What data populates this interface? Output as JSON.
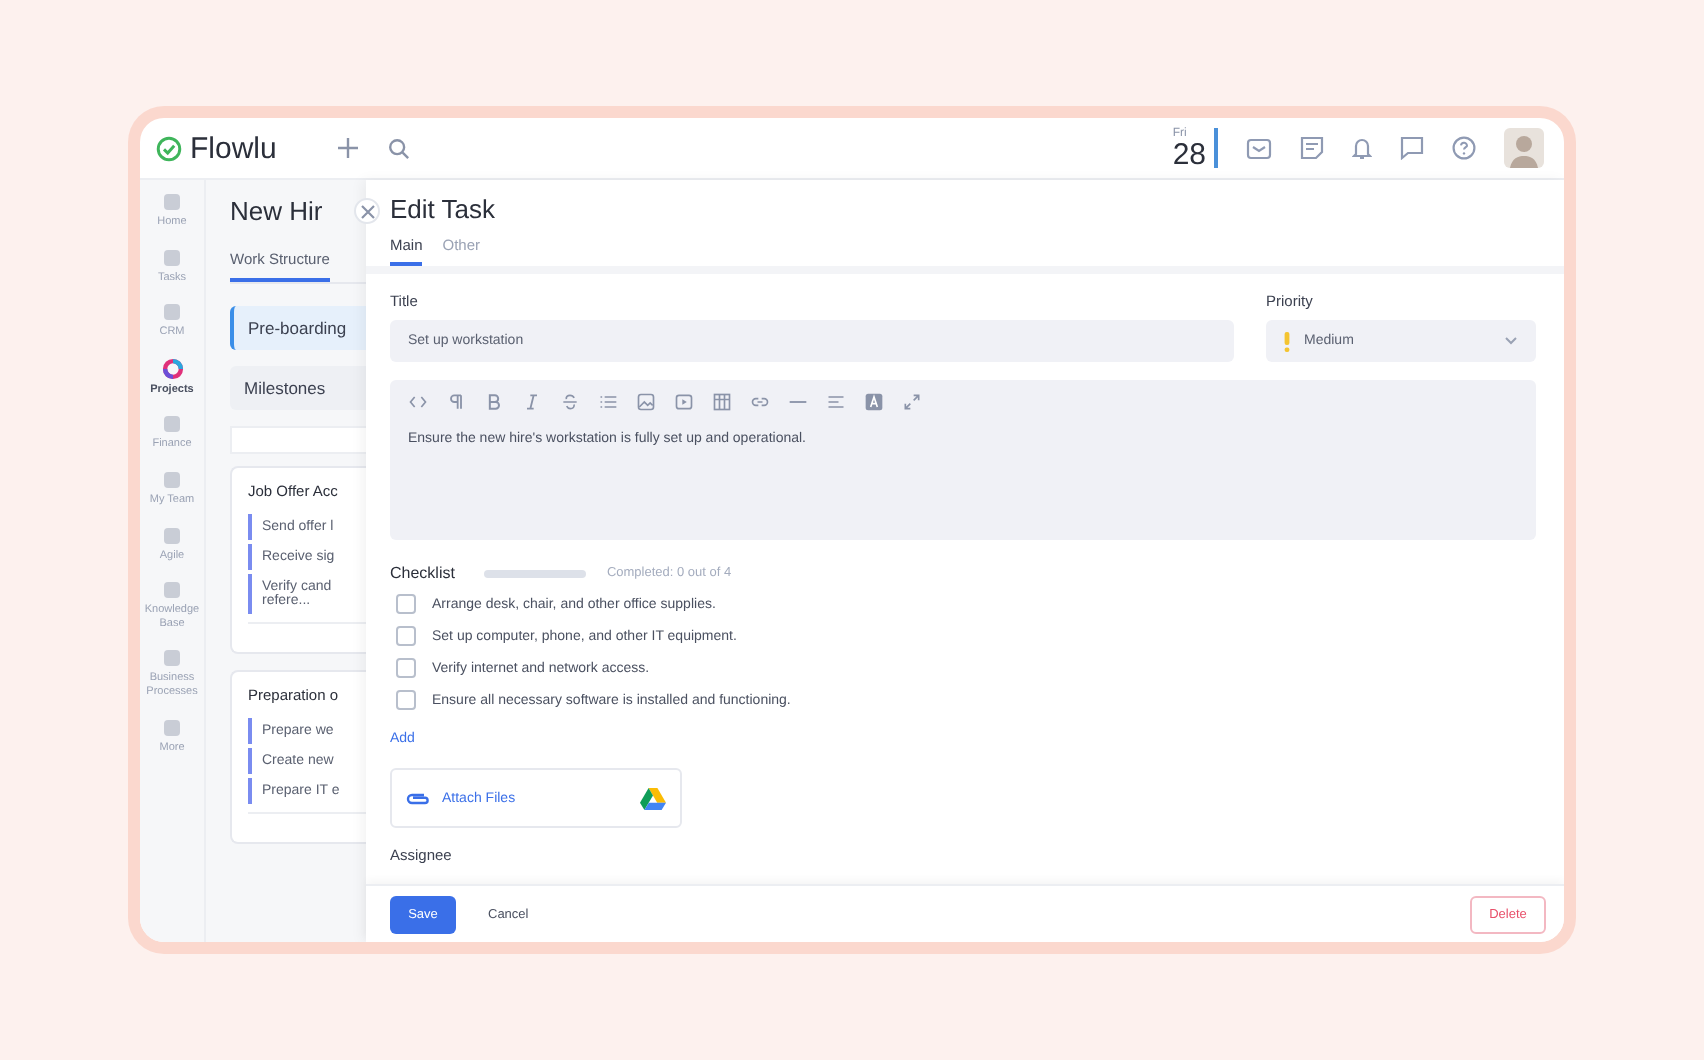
{
  "app": {
    "name": "Flowlu"
  },
  "topbar": {
    "day": "Fri",
    "date": "28",
    "icons": [
      {
        "kind": "mail"
      },
      {
        "kind": "note"
      },
      {
        "kind": "bell"
      },
      {
        "kind": "chat"
      },
      {
        "kind": "help"
      }
    ]
  },
  "sidebar": {
    "items": [
      {
        "label": "Home",
        "selected": false
      },
      {
        "label": "Tasks",
        "selected": false
      },
      {
        "label": "CRM",
        "selected": false
      },
      {
        "label": "Projects",
        "selected": true
      },
      {
        "label": "Finance",
        "selected": false
      },
      {
        "label": "My Team",
        "selected": false
      },
      {
        "label": "Agile",
        "selected": false
      },
      {
        "label": "Knowledge Base",
        "selected": false
      },
      {
        "label": "Business Processes",
        "selected": false
      },
      {
        "label": "More",
        "selected": false
      }
    ]
  },
  "project": {
    "title": "New Hir",
    "tabs": [
      {
        "label": "Work Structure",
        "selected": true
      }
    ],
    "stages": [
      {
        "label": "Pre-boarding",
        "selected": true
      },
      {
        "label": "Milestones",
        "selected": false
      }
    ],
    "cards": [
      {
        "title": "Job Offer Acc",
        "tasks": [
          "Send offer l",
          "Receive sig",
          "Verify cand refere..."
        ]
      },
      {
        "title": "Preparation o",
        "tasks": [
          "Prepare we",
          "Create new",
          "Prepare IT e"
        ]
      }
    ]
  },
  "drawer": {
    "title": "Edit Task",
    "tabs": [
      {
        "label": "Main",
        "selected": true
      },
      {
        "label": "Other",
        "selected": false
      }
    ],
    "title_label": "Title",
    "title_value": "Set up workstation",
    "priority_label": "Priority",
    "priority_value": "Medium",
    "toolbar": [
      {
        "kind": "code"
      },
      {
        "kind": "paragraph"
      },
      {
        "kind": "bold"
      },
      {
        "kind": "italic"
      },
      {
        "kind": "strike"
      },
      {
        "kind": "list"
      },
      {
        "kind": "image"
      },
      {
        "kind": "video"
      },
      {
        "kind": "table"
      },
      {
        "kind": "link"
      },
      {
        "kind": "rule"
      },
      {
        "kind": "align"
      },
      {
        "kind": "color"
      },
      {
        "kind": "expand"
      }
    ],
    "description": "Ensure the new hire's workstation is fully set up and operational.",
    "checklist": {
      "label": "Checklist",
      "level": 0,
      "summary": "Completed: 0 out of 4",
      "items": [
        {
          "text": "Arrange desk, chair, and other office supplies.",
          "checked": false
        },
        {
          "text": "Set up computer, phone, and other IT equipment.",
          "checked": false
        },
        {
          "text": "Verify internet and network access.",
          "checked": false
        },
        {
          "text": "Ensure all necessary software is installed and functioning.",
          "checked": false
        }
      ],
      "add": "Add"
    },
    "attach": "Attach Files",
    "assignee_label": "Assignee",
    "buttons": {
      "save": "Save",
      "cancel": "Cancel",
      "delete": "Delete"
    }
  }
}
